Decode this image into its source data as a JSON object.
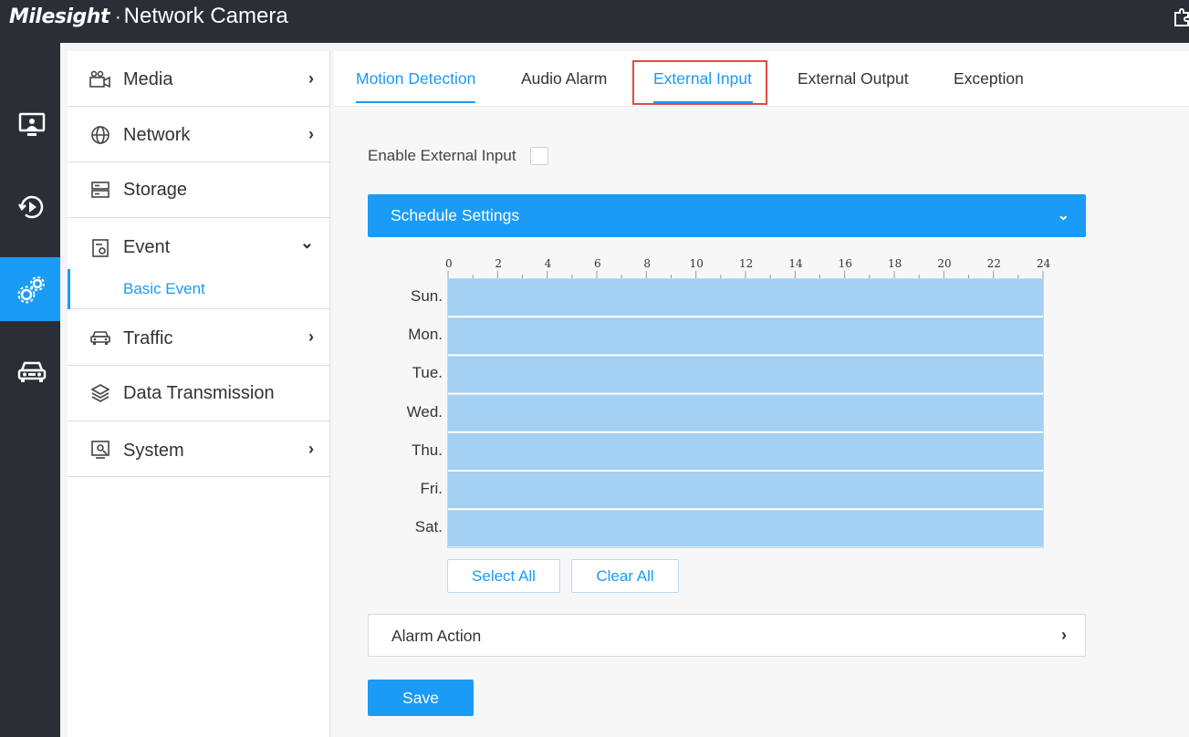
{
  "app": {
    "brand": "Milesight",
    "separator": "·",
    "product": "Network Camera"
  },
  "rail": {
    "items": [
      {
        "name": "live-view-icon"
      },
      {
        "name": "playback-icon"
      },
      {
        "name": "settings-icon",
        "active": true
      },
      {
        "name": "vehicle-icon"
      }
    ]
  },
  "sidebar": {
    "items": [
      {
        "label": "Media",
        "icon": "camera-icon",
        "chevron": "›"
      },
      {
        "label": "Network",
        "icon": "globe-icon",
        "chevron": "›"
      },
      {
        "label": "Storage",
        "icon": "storage-icon",
        "chevron": ""
      },
      {
        "label": "Event",
        "icon": "event-icon",
        "chevron": "⌄"
      },
      {
        "label": "Traffic",
        "icon": "car-icon",
        "chevron": "›"
      },
      {
        "label": "Data Transmission",
        "icon": "layers-icon",
        "chevron": ""
      },
      {
        "label": "System",
        "icon": "system-icon",
        "chevron": "›"
      }
    ],
    "submenu": {
      "label": "Basic Event"
    }
  },
  "tabs": [
    {
      "label": "Motion Detection",
      "active": true
    },
    {
      "label": "Audio Alarm"
    },
    {
      "label": "External Input",
      "highlighted": true
    },
    {
      "label": "External Output"
    },
    {
      "label": "Exception"
    }
  ],
  "enable": {
    "label": "Enable External Input",
    "checked": false
  },
  "schedule": {
    "title": "Schedule Settings",
    "chevron": "⌄",
    "hour_ticks": [
      "0",
      "2",
      "4",
      "6",
      "8",
      "10",
      "12",
      "14",
      "16",
      "18",
      "20",
      "22",
      "24"
    ],
    "days": [
      "Sun.",
      "Mon.",
      "Tue.",
      "Wed.",
      "Thu.",
      "Fri.",
      "Sat."
    ],
    "select_all": "Select All",
    "clear_all": "Clear All",
    "fill_color": "#a3d0f3"
  },
  "alarm_action": {
    "title": "Alarm Action",
    "chevron": "›"
  },
  "save": {
    "label": "Save"
  },
  "colors": {
    "accent": "#1a9bf5",
    "topbar": "#2a2e35",
    "highlight_box": "#e04b3f"
  }
}
